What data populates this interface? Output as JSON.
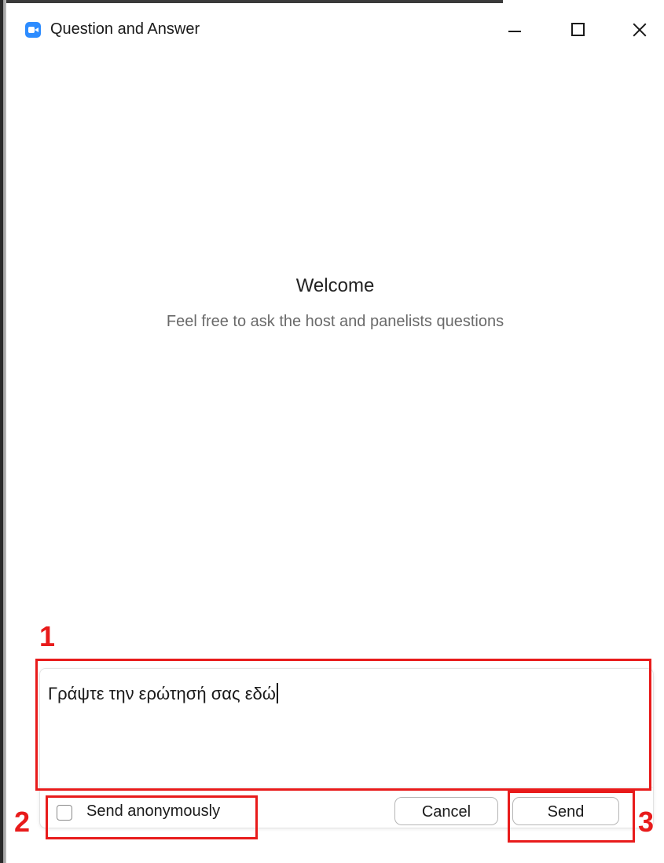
{
  "window": {
    "title": "Question and Answer",
    "accent_color": "#2d8cff"
  },
  "icons": {
    "app": "zoom-camera-icon",
    "minimize": "minimize-icon",
    "maximize": "maximize-icon",
    "close": "close-icon"
  },
  "main": {
    "welcome_title": "Welcome",
    "welcome_subtitle": "Feel free to ask the host and panelists questions"
  },
  "compose": {
    "question_text": "Γράψτε την ερώτησή σας εδώ",
    "anonymous_label": "Send anonymously",
    "anonymous_checked": false,
    "cancel_label": "Cancel",
    "send_label": "Send"
  },
  "annotations": {
    "color": "#e81b1b",
    "labels": [
      "1",
      "2",
      "3"
    ]
  }
}
